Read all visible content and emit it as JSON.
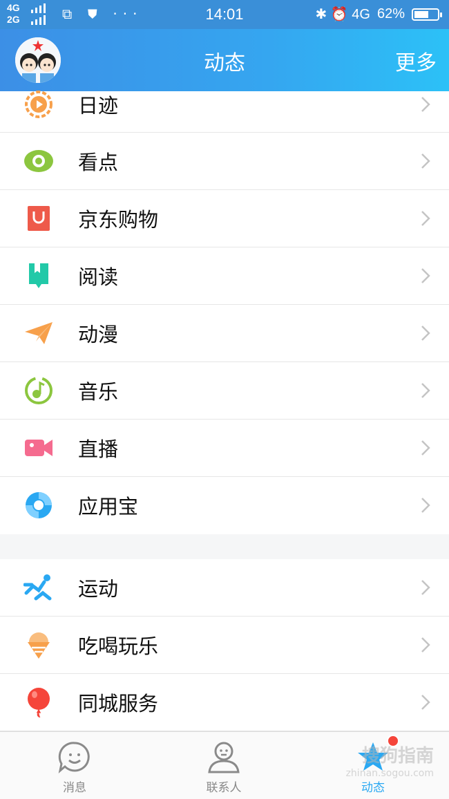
{
  "status_bar": {
    "network_top": "4G",
    "network_bottom": "2G",
    "left_icons": "⧉ ⛊ ···",
    "time": "14:01",
    "right_icons": "✱ ⏰ 4G",
    "battery_percent": "62%",
    "battery_level": 0.62
  },
  "header": {
    "title": "动态",
    "more_label": "更多"
  },
  "list": {
    "group1": [
      {
        "label": "日迹",
        "icon": "play-ring-icon",
        "color": "#f7a04b"
      },
      {
        "label": "看点",
        "icon": "eye-icon",
        "color": "#8cc63f"
      },
      {
        "label": "京东购物",
        "icon": "jd-bag-icon",
        "color": "#ee5a4a"
      },
      {
        "label": "阅读",
        "icon": "book-icon",
        "color": "#22c9a8"
      },
      {
        "label": "动漫",
        "icon": "paper-plane-icon",
        "color": "#f7a04b"
      },
      {
        "label": "音乐",
        "icon": "music-note-icon",
        "color": "#8cc63f"
      },
      {
        "label": "直播",
        "icon": "video-camera-icon",
        "color": "#f56b8f"
      },
      {
        "label": "应用宝",
        "icon": "appstore-icon",
        "color": "#2aa8f2"
      }
    ],
    "group2": [
      {
        "label": "运动",
        "icon": "running-icon",
        "color": "#2aa8f2"
      },
      {
        "label": "吃喝玩乐",
        "icon": "ice-cream-icon",
        "color": "#f7a04b"
      },
      {
        "label": "同城服务",
        "icon": "balloon-icon",
        "color": "#f5453a"
      }
    ]
  },
  "tabbar": {
    "tabs": [
      {
        "label": "消息",
        "icon": "chat-bubble-icon",
        "active": false
      },
      {
        "label": "联系人",
        "icon": "contact-person-icon",
        "active": false
      },
      {
        "label": "动态",
        "icon": "star-icon",
        "active": true
      }
    ],
    "watermark": "搜狗指南",
    "watermark_sub": "zhinan.sogou.com"
  },
  "colors": {
    "accent": "#2aa8f2",
    "header_start": "#3c8fe6",
    "header_end": "#2cc1f7",
    "badge": "#f5453a"
  }
}
